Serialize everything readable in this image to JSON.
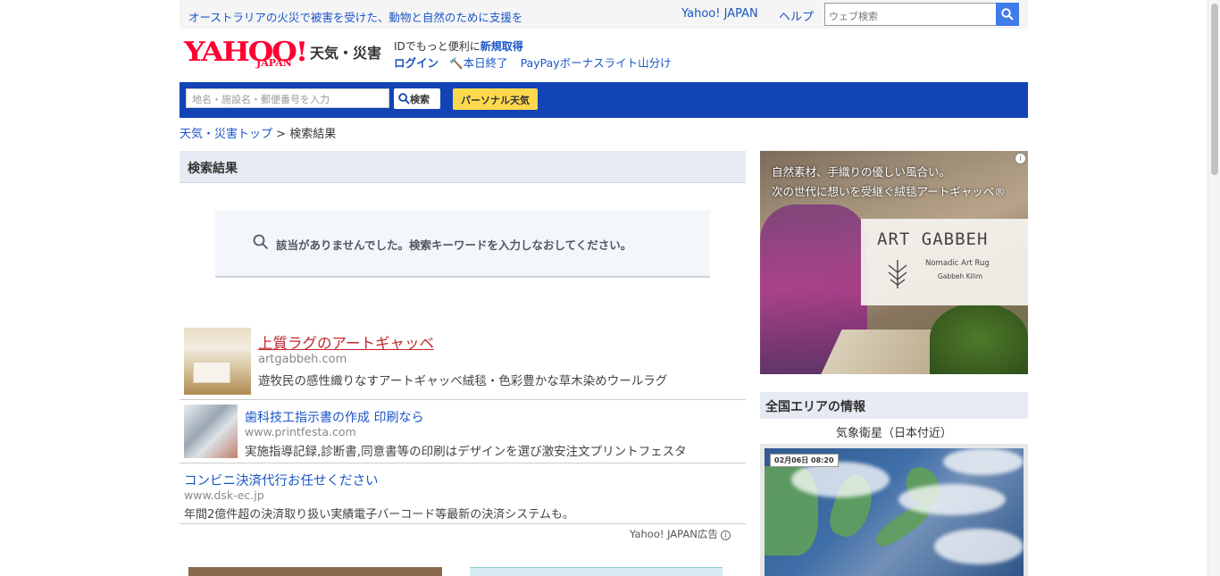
{
  "topbar": {
    "promo": "オーストラリアの火災で被害を受けた、動物と自然のために支援を",
    "yahoo_japan": "Yahoo! JAPAN",
    "help": "ヘルプ",
    "search_placeholder": "ウェブ検索"
  },
  "header": {
    "logo_yahoo": "YAHOO!",
    "logo_japan": "JAPAN",
    "service_name": "天気・災害",
    "id_text": "IDでもっと便利に",
    "signup": "新規取得",
    "login": "ログイン",
    "today_end": "本日終了",
    "paypay": "PayPayボーナスライト山分け"
  },
  "search_band": {
    "placeholder": "地名・施設名・郵便番号を入力",
    "search_label": "検索",
    "personal_label": "パーソナル天気"
  },
  "breadcrumb": {
    "top": "天気・災害トップ",
    "separator": " > ",
    "current": "検索結果"
  },
  "results": {
    "heading": "検索結果",
    "no_result": "該当がありませんでした。検索キーワードを入力しなおしてください。"
  },
  "ads": [
    {
      "title": "上質ラグのアートギャッベ",
      "url": "artgabbeh.com",
      "desc": "遊牧民の感性織りなすアートギャッベ絨毯・色彩豊かな草木染めウールラグ"
    },
    {
      "title": "歯科技工指示書の作成 印刷なら",
      "url": "www.printfesta.com",
      "desc": "実施指導記録,診断書,同意書等の印刷はデザインを選び激安注文プリントフェスタ"
    },
    {
      "title": "コンビニ決済代行お任せください",
      "url": "www.dsk-ec.jp",
      "desc": "年間2億件超の決済取り扱い実績電子バーコード等最新の決済システムも。"
    }
  ],
  "ad_credit": "Yahoo! JAPAN広告",
  "banner": {
    "line1": "自然素材、手織りの優しい風合い。",
    "line2": "次の世代に想いを受継ぐ絨毯アートギャッベ®",
    "brand": "ART GABBEH",
    "sub1": "Nomadic Art Rug",
    "sub2": "Gabbeh  Kilim"
  },
  "area": {
    "heading": "全国エリアの情報",
    "satellite_label": "気象衛星（日本付近）",
    "satellite_stamp": "02月06日 08:20"
  },
  "colors": {
    "band": "#1244b6",
    "link": "#1a55c7",
    "ad_title_red": "#c0282d",
    "personal_button": "#ffd94d",
    "section_header": "#e6eaf3"
  }
}
